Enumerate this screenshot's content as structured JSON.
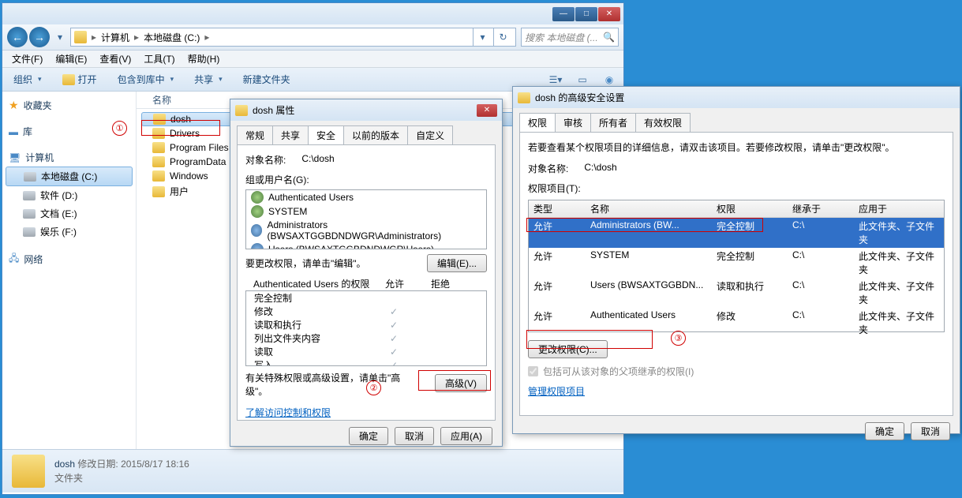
{
  "explorer": {
    "breadcrumb": [
      "计算机",
      "本地磁盘 (C:)"
    ],
    "search_placeholder": "搜索 本地磁盘 (...",
    "menu": [
      "文件(F)",
      "编辑(E)",
      "查看(V)",
      "工具(T)",
      "帮助(H)"
    ],
    "toolbar": {
      "organize": "组织",
      "open": "打开",
      "include": "包含到库中",
      "share": "共享",
      "newfolder": "新建文件夹"
    },
    "sidebar": {
      "favorites": "收藏夹",
      "libraries": "库",
      "computer": "计算机",
      "drives": [
        "本地磁盘 (C:)",
        "软件 (D:)",
        "文档 (E:)",
        "娱乐 (F:)"
      ],
      "network": "网络"
    },
    "col_name": "名称",
    "folders": [
      "dosh",
      "Drivers",
      "Program Files",
      "ProgramData",
      "Windows",
      "用户"
    ],
    "status": {
      "name": "dosh",
      "date_label": "修改日期:",
      "date": "2015/8/17 18:16",
      "type": "文件夹"
    }
  },
  "props": {
    "title": "dosh 属性",
    "tabs": [
      "常规",
      "共享",
      "安全",
      "以前的版本",
      "自定义"
    ],
    "object_label": "对象名称:",
    "object": "C:\\dosh",
    "groups_label": "组或用户名(G):",
    "groups": [
      "Authenticated Users",
      "SYSTEM",
      "Administrators (BWSAXTGGBDNDWGR\\Administrators)",
      "Users (BWSAXTGGBDNDWGR\\Users)"
    ],
    "edit_hint": "要更改权限，请单击\"编辑\"。",
    "edit_btn": "编辑(E)...",
    "perm_title": "Authenticated Users 的权限",
    "allow": "允许",
    "deny": "拒绝",
    "perms": [
      "完全控制",
      "修改",
      "读取和执行",
      "列出文件夹内容",
      "读取",
      "写入"
    ],
    "adv_hint1": "有关特殊权限或高级设置，请单击\"高",
    "adv_hint2": "级\"。",
    "adv_btn": "高级(V)",
    "link": "了解访问控制和权限",
    "ok": "确定",
    "cancel": "取消",
    "apply": "应用(A)"
  },
  "adv": {
    "title": "dosh 的高级安全设置",
    "tabs": [
      "权限",
      "审核",
      "所有者",
      "有效权限"
    ],
    "hint": "若要查看某个权限项目的详细信息，请双击该项目。若要修改权限，请单击\"更改权限\"。",
    "object_label": "对象名称:",
    "object": "C:\\dosh",
    "list_label": "权限项目(T):",
    "cols": [
      "类型",
      "名称",
      "权限",
      "继承于",
      "应用于"
    ],
    "rows": [
      {
        "type": "允许",
        "name": "Administrators (BW...",
        "perm": "完全控制",
        "inh": "C:\\",
        "apply": "此文件夹、子文件夹"
      },
      {
        "type": "允许",
        "name": "SYSTEM",
        "perm": "完全控制",
        "inh": "C:\\",
        "apply": "此文件夹、子文件夹"
      },
      {
        "type": "允许",
        "name": "Users (BWSAXTGGBDN...",
        "perm": "读取和执行",
        "inh": "C:\\",
        "apply": "此文件夹、子文件夹"
      },
      {
        "type": "允许",
        "name": "Authenticated Users",
        "perm": "修改",
        "inh": "C:\\",
        "apply": "此文件夹、子文件夹"
      }
    ],
    "change_btn": "更改权限(C)...",
    "inherit_chk": "包括可从该对象的父项继承的权限(I)",
    "manage_link": "管理权限项目",
    "ok": "确定",
    "cancel": "取消"
  },
  "annotations": {
    "1": "①",
    "2": "②",
    "3": "③"
  }
}
